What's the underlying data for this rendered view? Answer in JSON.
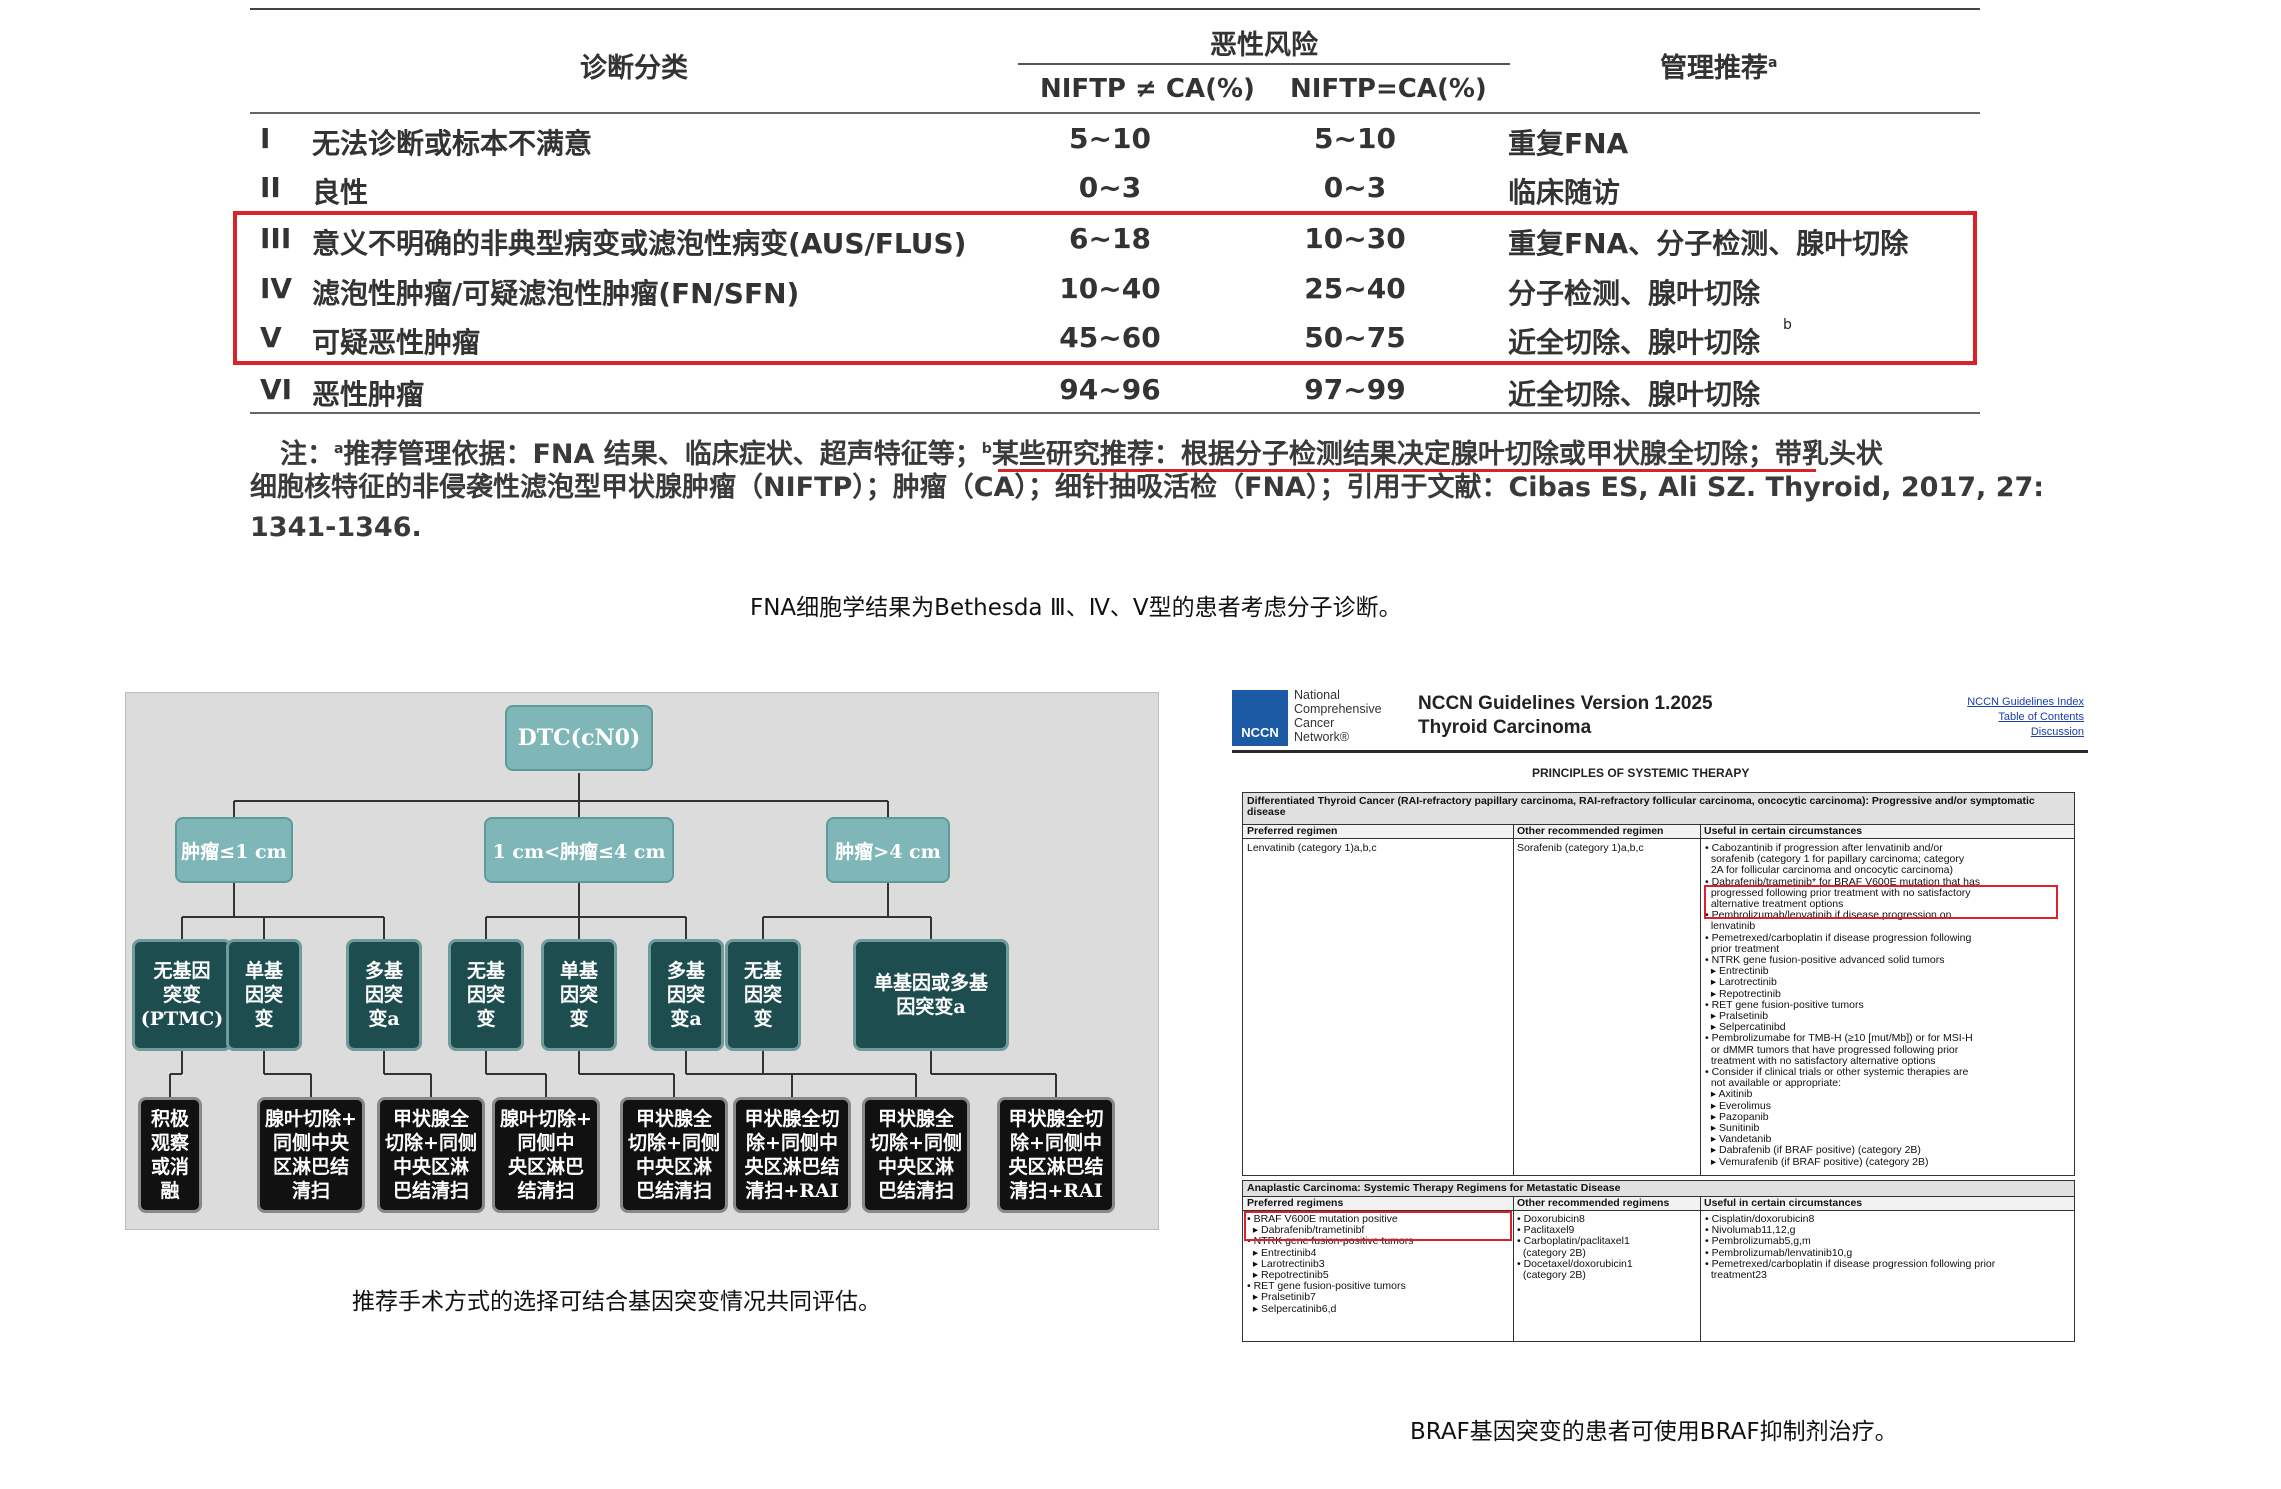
{
  "bethesda": {
    "header": {
      "diagnosis": "诊断分类",
      "risk": "恶性风险",
      "niftp_ne": "NIFTP ≠ CA(%)",
      "niftp_eq": "NIFTP=CA(%)",
      "management": "管理推荐",
      "management_sup": "a"
    },
    "rows": [
      {
        "num": "I",
        "dx": "无法诊断或标本不满意",
        "r1": "5~10",
        "r2": "5~10",
        "mgmt": "重复FNA",
        "sup": ""
      },
      {
        "num": "II",
        "dx": "良性",
        "r1": "0~3",
        "r2": "0~3",
        "mgmt": "临床随访",
        "sup": ""
      },
      {
        "num": "III",
        "dx": "意义不明确的非典型病变或滤泡性病变(AUS/FLUS)",
        "r1": "6~18",
        "r2": "10~30",
        "mgmt": "重复FNA、分子检测、腺叶切除",
        "sup": ""
      },
      {
        "num": "IV",
        "dx": "滤泡性肿瘤/可疑滤泡性肿瘤(FN/SFN)",
        "r1": "10~40",
        "r2": "25~40",
        "mgmt": "分子检测、腺叶切除",
        "sup": ""
      },
      {
        "num": "V",
        "dx": "可疑恶性肿瘤",
        "r1": "45~60",
        "r2": "50~75",
        "mgmt": "近全切除、腺叶切除",
        "sup": "b"
      },
      {
        "num": "VI",
        "dx": "恶性肿瘤",
        "r1": "94~96",
        "r2": "97~99",
        "mgmt": "近全切除、腺叶切除",
        "sup": ""
      }
    ],
    "note_line1_a": "注：",
    "note_line1_a_sup": "a",
    "note_line1_b": "推荐管理依据：FNA 结果、临床症状、超声特征等；",
    "note_line1_b_sup": "b",
    "note_line1_c": "某些研究推荐：根据分子检测结果决定腺叶切除或甲状腺全切除；带乳头状",
    "note_line2": "细胞核特征的非侵袭性滤泡型甲状腺肿瘤（NIFTP）；肿瘤（CA）；细针抽吸活检（FNA）；引用于文献：Cibas ES, Ali SZ. Thyroid, 2017, 27:",
    "note_line3": "1341-1346.",
    "caption": "FNA细胞学结果为Bethesda Ⅲ、Ⅳ、Ⅴ型的患者考虑分子诊断。",
    "highlight_color": "#d9222a"
  },
  "flowchart": {
    "root": "DTC(cN0)",
    "level1": [
      "肿瘤≤1 cm",
      "1 cm<肿瘤≤4 cm",
      "肿瘤>4 cm"
    ],
    "level2": [
      [
        "无基因",
        "突变",
        "(PTMC)"
      ],
      [
        "单基",
        "因突",
        "变"
      ],
      [
        "多基",
        "因突",
        "变a"
      ],
      [
        "无基",
        "因突",
        "变"
      ],
      [
        "单基",
        "因突",
        "变"
      ],
      [
        "多基",
        "因突",
        "变a"
      ],
      [
        "无基",
        "因突",
        "变"
      ],
      [
        "单基因或多基",
        "因突变a"
      ]
    ],
    "level3": [
      [
        "积极",
        "观察",
        "或消",
        "融"
      ],
      [
        "腺叶切除+",
        "同侧中央",
        "区淋巴结",
        "清扫"
      ],
      [
        "甲状腺全",
        "切除+同侧",
        "中央区淋",
        "巴结清扫"
      ],
      [
        "腺叶切除+",
        "同侧中",
        "央区淋巴",
        "结清扫"
      ],
      [
        "甲状腺全",
        "切除+同侧",
        "中央区淋",
        "巴结清扫"
      ],
      [
        "甲状腺全切",
        "除+同侧中",
        "央区淋巴结",
        "清扫+RAI"
      ],
      [
        "甲状腺全",
        "切除+同侧",
        "中央区淋",
        "巴结清扫"
      ],
      [
        "甲状腺全切",
        "除+同侧中",
        "央区淋巴结",
        "清扫+RAI"
      ]
    ],
    "caption": "推荐手术方式的选择可结合基因突变情况共同评估。",
    "colors": {
      "teal": "#7fb7b8",
      "dark_teal": "#1e4d4f",
      "black": "#111111",
      "background": "#dcdcdc"
    }
  },
  "nccn": {
    "logo": "NCCN",
    "org_lines": [
      "National",
      "Comprehensive",
      "Cancer",
      "Network®"
    ],
    "title_line1": "NCCN Guidelines Version 1.2025",
    "title_line2": "Thyroid Carcinoma",
    "links": [
      "NCCN Guidelines Index",
      "Table of Contents",
      "Discussion"
    ],
    "section_title": "PRINCIPLES OF SYSTEMIC THERAPY",
    "dtc_header": "Differentiated Thyroid Cancer (RAI-refractory papillary carcinoma, RAI-refractory follicular carcinoma, oncocytic carcinoma): Progressive and/or symptomatic disease",
    "col_heads": [
      "Preferred regimen",
      "Other recommended regimen",
      "Useful in certain circumstances"
    ],
    "dtc_preferred": "Lenvatinib (category 1)a,b,c",
    "dtc_other": "Sorafenib (category 1)a,b,c",
    "dtc_useful": [
      "• Cabozantinib if progression after lenvatinib and/or",
      "  sorafenib (category 1 for papillary carcinoma; category",
      "  2A for follicular carcinoma and oncocytic carcinoma)",
      "• Dabrafenib/trametinib* for BRAF V600E mutation that has",
      "  progressed following prior treatment with no satisfactory",
      "  alternative treatment options",
      "• Pembrolizumab/lenvatinib if disease progression on",
      "  lenvatinib",
      "• Pemetrexed/carboplatin if disease progression following",
      "  prior treatment",
      "• NTRK gene fusion-positive advanced solid tumors",
      "  ▸ Entrectinib",
      "  ▸ Larotrectinib",
      "  ▸ Repotrectinib",
      "• RET gene fusion-positive tumors",
      "  ▸ Pralsetinib",
      "  ▸ Selpercatinibd",
      "• Pembrolizumabe for TMB-H (≥10 [mut/Mb]) or for MSI-H",
      "  or dMMR tumors that have progressed following prior",
      "  treatment with no satisfactory alternative options",
      "• Consider if clinical trials or other systemic therapies are",
      "  not available or appropriate:",
      "  ▸ Axitinib",
      "  ▸ Everolimus",
      "  ▸ Pazopanib",
      "  ▸ Sunitinib",
      "  ▸ Vandetanib",
      "  ▸ Dabrafenib (if BRAF positive) (category 2B)",
      "  ▸ Vemurafenib (if BRAF positive) (category 2B)"
    ],
    "ana_header": "Anaplastic Carcinoma: Systemic Therapy Regimens for Metastatic Disease",
    "ana_col_heads": [
      "Preferred regimens",
      "Other recommended regimens",
      "Useful in certain circumstances"
    ],
    "ana_preferred": [
      "• BRAF V600E mutation positive",
      "  ▸ Dabrafenib/trametinibf",
      "• NTRK gene fusion-positive tumors",
      "  ▸ Entrectinib4",
      "  ▸ Larotrectinib3",
      "  ▸ Repotrectinib5",
      "• RET gene fusion-positive tumors",
      "  ▸ Pralsetinib7",
      "  ▸ Selpercatinib6,d"
    ],
    "ana_other": [
      "• Doxorubicin8",
      "• Paclitaxel9",
      "• Carboplatin/paclitaxel1",
      "  (category 2B)",
      "• Docetaxel/doxorubicin1",
      "  (category 2B)"
    ],
    "ana_useful": [
      "• Cisplatin/doxorubicin8",
      "• Nivolumab11,12,g",
      "• Pembrolizumab5,g,m",
      "• Pembrolizumab/lenvatinib10,g",
      "• Pemetrexed/carboplatin if disease progression following prior",
      "  treatment23"
    ],
    "caption": "BRAF基因突变的患者可使用BRAF抑制剂治疗。",
    "logo_color": "#1c5aa6"
  }
}
